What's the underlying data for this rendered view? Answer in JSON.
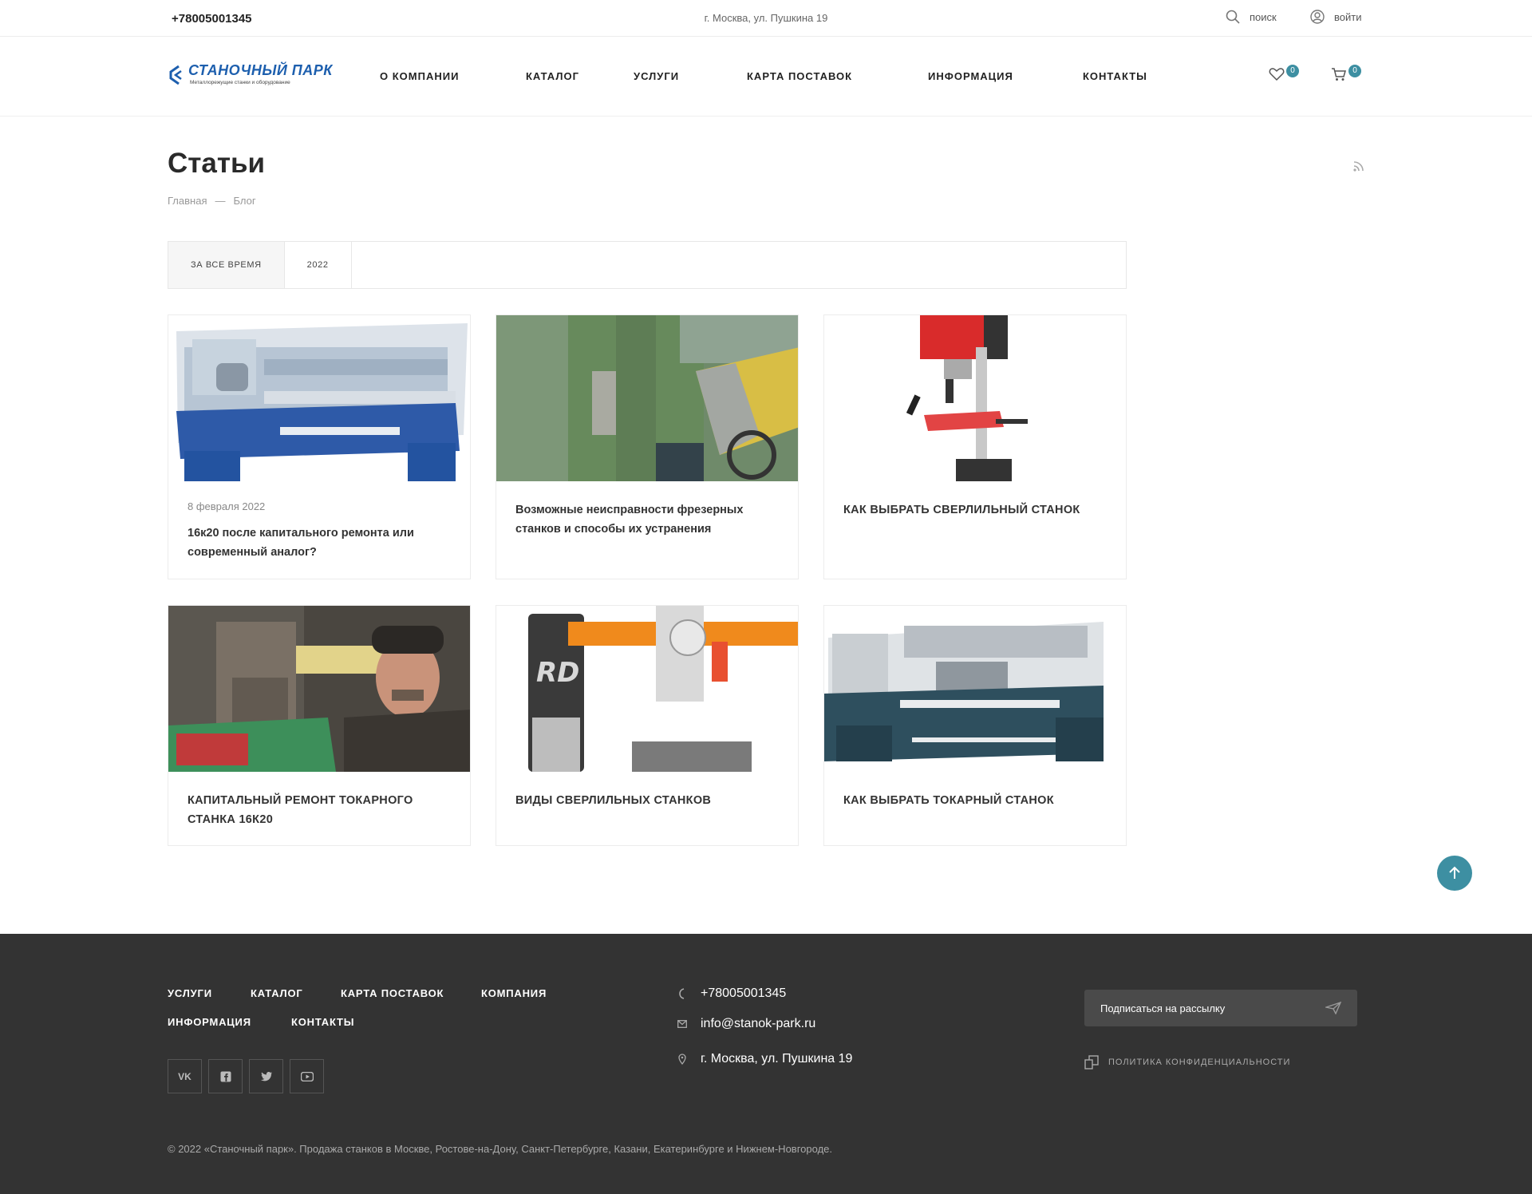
{
  "topbar": {
    "phone": "+78005001345",
    "address": "г. Москва, ул. Пушкина 19",
    "search_label": "поиск",
    "login_label": "войти"
  },
  "logo": {
    "title": "СТАНОЧНЫЙ ПАРК",
    "subtitle": "Металлорежущие станки и оборудование"
  },
  "nav": [
    {
      "label": "О КОМПАНИИ"
    },
    {
      "label": "КАТАЛОГ"
    },
    {
      "label": "УСЛУГИ"
    },
    {
      "label": "КАРТА ПОСТАВОК"
    },
    {
      "label": "ИНФОРМАЦИЯ"
    },
    {
      "label": "КОНТАКТЫ"
    }
  ],
  "header_counters": {
    "favorites": "0",
    "cart": "0"
  },
  "page": {
    "title": "Статьи",
    "breadcrumb": [
      "Главная",
      "—",
      "Блог"
    ]
  },
  "filter_tabs": [
    {
      "label": "ЗА ВСЕ ВРЕМЯ",
      "active": true
    },
    {
      "label": "2022",
      "active": false
    }
  ],
  "articles": [
    {
      "date": "8 февраля 2022",
      "title": "16к20 после капитального ремонта или современный аналог?",
      "image": "lathe-blue"
    },
    {
      "date": "",
      "title": "Возможные неисправности фрезерных станков и способы их устранения",
      "image": "milling-machine-green"
    },
    {
      "date": "",
      "title": "КАК ВЫБРАТЬ СВЕРЛИЛЬНЫЙ СТАНОК",
      "image": "drill-press-red"
    },
    {
      "date": "",
      "title": "КАПИТАЛЬНЫЙ РЕМОНТ ТОКАРНОГО СТАНКА 16К20",
      "image": "worker-repair"
    },
    {
      "date": "",
      "title": "ВИДЫ СВЕРЛИЛЬНЫХ СТАНКОВ",
      "image": "radial-drill-orange"
    },
    {
      "date": "",
      "title": "КАК ВЫБРАТЬ ТОКАРНЫЙ СТАНОК",
      "image": "lathe-teal"
    }
  ],
  "footer": {
    "nav": [
      "УСЛУГИ",
      "КАТАЛОГ",
      "КАРТА ПОСТАВОК",
      "КОМПАНИЯ",
      "ИНФОРМАЦИЯ",
      "КОНТАКТЫ"
    ],
    "social": [
      "vk-icon",
      "facebook-icon",
      "twitter-icon",
      "youtube-icon"
    ],
    "vk_label": "VK",
    "phone": "+78005001345",
    "email": "info@stanok-park.ru",
    "address": "г. Москва, ул. Пушкина 19",
    "subscribe_label": "Подписаться на рассылку",
    "privacy_label": "ПОЛИТИКА КОНФИДЕНЦИАЛЬНОСТИ",
    "copyright": "© 2022 «Станочный парк». Продажа станков в Москве, Ростове-на-Дону, Санкт-Петербурге, Казани, Екатеринбурге и Нижнем-Новгороде."
  },
  "colors": {
    "accent": "#3d8fa2",
    "footer_bg": "#333333",
    "logo_blue": "#1d5fae"
  }
}
